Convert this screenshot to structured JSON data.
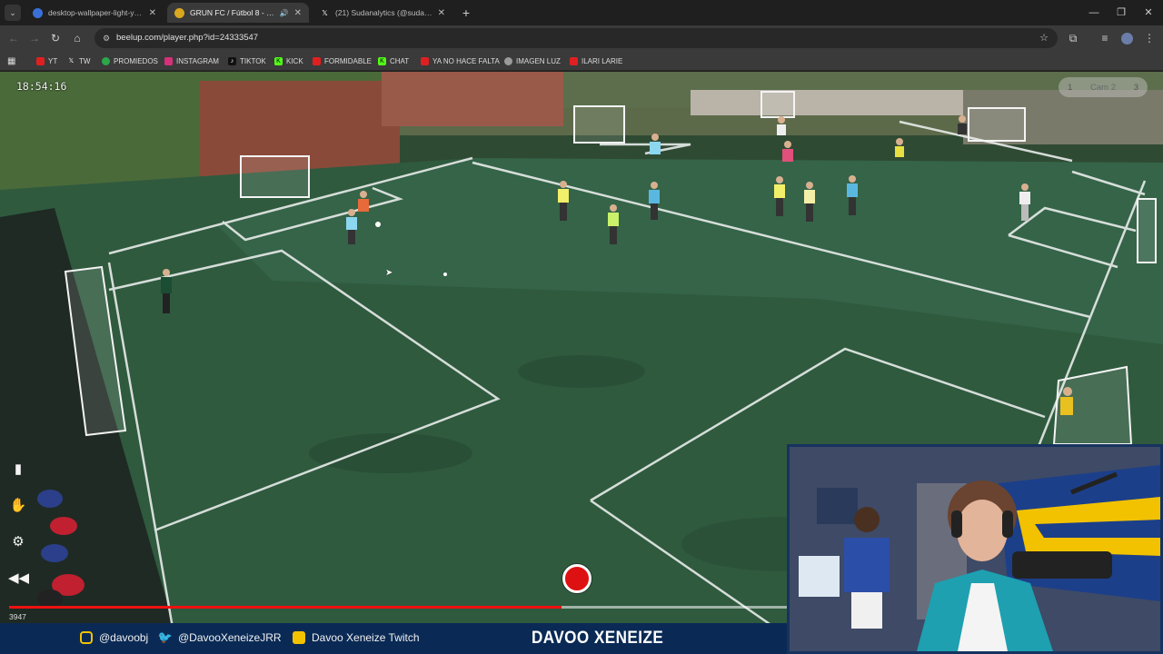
{
  "tabs": [
    {
      "title": "desktop-wallpaper-light-yellow...",
      "active": false,
      "favicon_color": "#3a6fd8"
    },
    {
      "title": "GRUN FC / Fútbol 8 - Canc...",
      "active": true,
      "favicon_color": "#d9a820",
      "audio_icon": "speaker-icon"
    },
    {
      "title": "(21) Sudanalytics (@sudanalyti...",
      "active": false,
      "favicon_color": "#ffffff"
    }
  ],
  "toolbar": {
    "url": "beelup.com/player.php?id=24333547"
  },
  "bookmarks": [
    {
      "label": "YT",
      "color": "#e02020"
    },
    {
      "label": "TW",
      "color": "#ffffff"
    },
    {
      "label": "PROMIEDOS",
      "color": "#2aa84a"
    },
    {
      "label": "INSTAGRAM",
      "color": "#d6307a"
    },
    {
      "label": "TIKTOK",
      "color": "#111111"
    },
    {
      "label": "KICK",
      "color": "#53fc18"
    },
    {
      "label": "FORMIDABLE",
      "color": "#e02020"
    },
    {
      "label": "CHAT",
      "color": "#53fc18"
    },
    {
      "label": "YA NO HACE FALTA",
      "color": "#e02020"
    },
    {
      "label": "IMAGEN LUZ",
      "color": "#9a9a9a"
    },
    {
      "label": "ILARI LARIE",
      "color": "#e02020"
    }
  ],
  "player": {
    "timestamp": "18:54:16",
    "camera": {
      "left": "1",
      "current": "Cam 2",
      "right": "3"
    },
    "counter": "3947",
    "progress_fraction": 0.71,
    "progress_color": "#ee1111",
    "record_color": "#dd1111"
  },
  "overlay": {
    "social": [
      {
        "label": "@davoobj",
        "icon": "instagram-icon",
        "color": "#f2c200"
      },
      {
        "label": "@DavooXeneizeJRR",
        "icon": "twitter-icon",
        "color": "#f2c200"
      },
      {
        "label": "Davoo Xeneize Twitch",
        "icon": "twitch-icon",
        "color": "#f2c200"
      }
    ],
    "brand": "DAVOO XENEIZE",
    "bar_color": "#0a2a55"
  }
}
